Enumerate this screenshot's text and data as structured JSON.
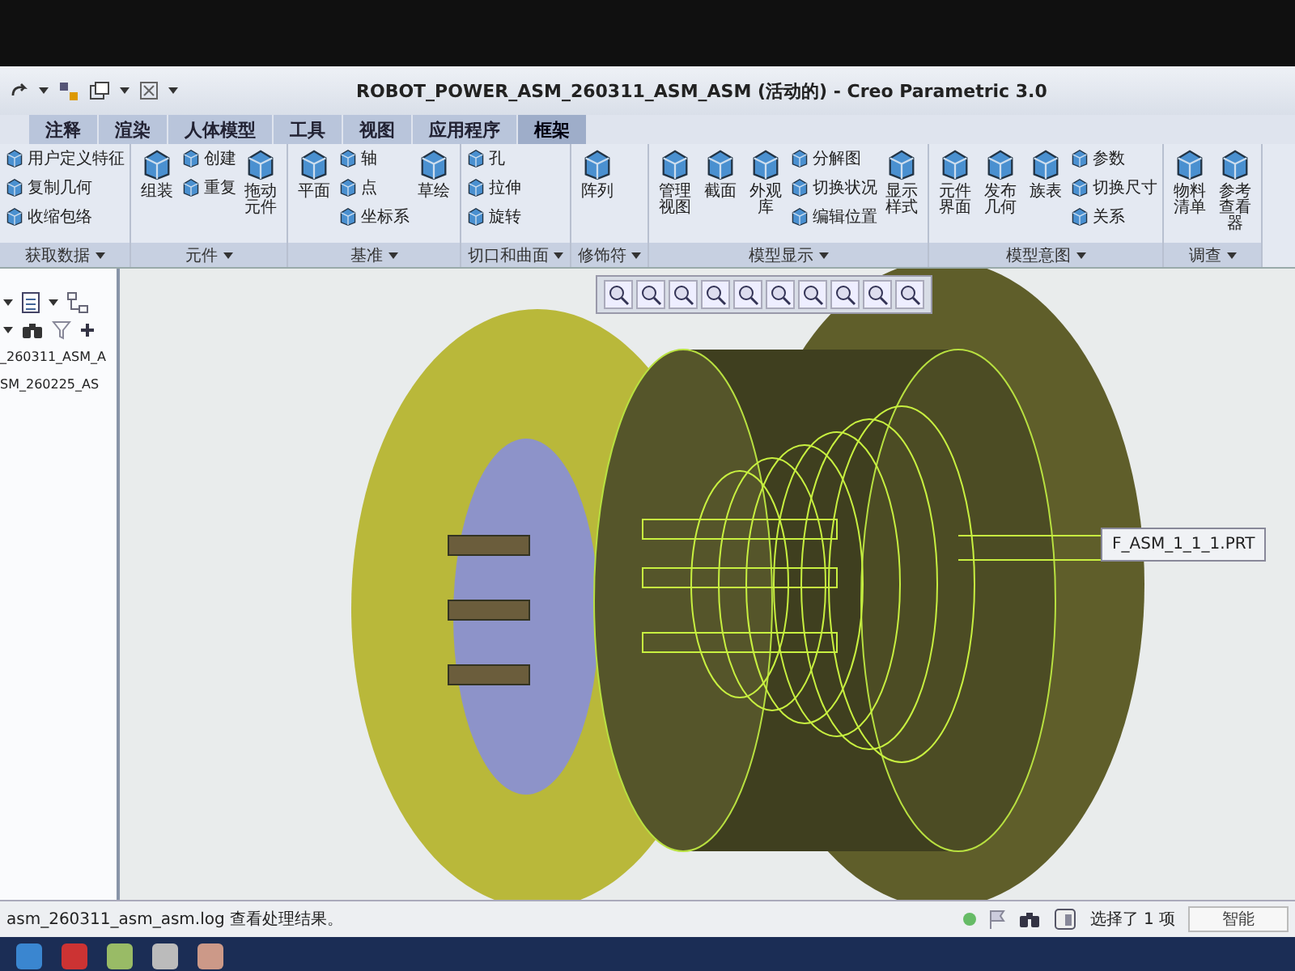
{
  "window": {
    "title": "ROBOT_POWER_ASM_260311_ASM_ASM (活动的) - Creo Parametric 3.0"
  },
  "tabs": [
    {
      "label": "注释",
      "selected": false
    },
    {
      "label": "渲染",
      "selected": false
    },
    {
      "label": "人体模型",
      "selected": false
    },
    {
      "label": "工具",
      "selected": false
    },
    {
      "label": "视图",
      "selected": false
    },
    {
      "label": "应用程序",
      "selected": false
    },
    {
      "label": "框架",
      "selected": true
    }
  ],
  "ribbon": {
    "groups": [
      {
        "label": "获取数据",
        "columns": [
          {
            "kind": "stack",
            "items": [
              "用户定义特征",
              "复制几何",
              "收缩包络"
            ]
          }
        ]
      },
      {
        "label": "元件",
        "columns": [
          {
            "kind": "large",
            "label": "组装"
          },
          {
            "kind": "stack",
            "items": [
              "创建",
              "重复"
            ]
          },
          {
            "kind": "large",
            "label": "拖动元件"
          }
        ]
      },
      {
        "label": "基准",
        "columns": [
          {
            "kind": "large",
            "label": "平面"
          },
          {
            "kind": "stack",
            "items": [
              "轴",
              "点",
              "坐标系"
            ]
          },
          {
            "kind": "large",
            "label": "草绘"
          }
        ]
      },
      {
        "label": "切口和曲面",
        "columns": [
          {
            "kind": "stack",
            "items": [
              "孔",
              "拉伸",
              "旋转"
            ]
          }
        ]
      },
      {
        "label": "修饰符",
        "columns": [
          {
            "kind": "large",
            "label": "阵列"
          }
        ]
      },
      {
        "label": "模型显示",
        "columns": [
          {
            "kind": "large",
            "label": "管理视图"
          },
          {
            "kind": "large",
            "label": "截面"
          },
          {
            "kind": "large",
            "label": "外观库"
          },
          {
            "kind": "stack",
            "items": [
              "分解图",
              "切换状况",
              "编辑位置"
            ]
          },
          {
            "kind": "large",
            "label": "显示样式"
          }
        ]
      },
      {
        "label": "模型意图",
        "columns": [
          {
            "kind": "large",
            "label": "元件界面"
          },
          {
            "kind": "large",
            "label": "发布几何"
          },
          {
            "kind": "large",
            "label": "族表"
          },
          {
            "kind": "stack",
            "items": [
              "参数",
              "切换尺寸",
              "关系"
            ]
          }
        ]
      },
      {
        "label": "调查",
        "columns": [
          {
            "kind": "large",
            "label": "物料清单"
          },
          {
            "kind": "large",
            "label": "参考查看器"
          }
        ]
      }
    ]
  },
  "model_tree": {
    "items": [
      "_260311_ASM_A",
      "SM_260225_AS"
    ]
  },
  "tooltip": "F_ASM_1_1_1.PRT",
  "status_bar": {
    "message": "asm_260311_asm_asm.log 查看处理结果。",
    "selection": "选择了 1 项",
    "filter": "智能"
  }
}
